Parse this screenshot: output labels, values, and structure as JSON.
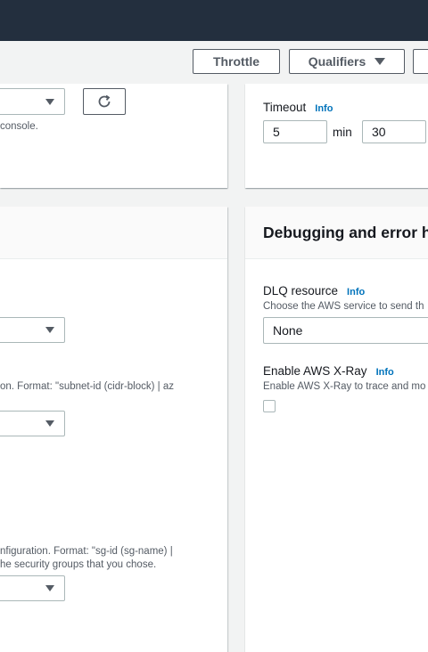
{
  "toolbar": {
    "throttle_label": "Throttle",
    "qualifiers_label": "Qualifiers"
  },
  "left_top": {
    "hint_text": "console."
  },
  "timeout": {
    "label": "Timeout",
    "info": "Info",
    "minutes_value": "5",
    "min_unit": "min",
    "seconds_value": "30"
  },
  "vpc": {
    "subnet_hint": "on. Format: \"subnet-id (cidr-block) | az",
    "sg_hint_line1": "nfiguration. Format: \"sg-id (sg-name) |",
    "sg_hint_line2": "he security groups that you chose."
  },
  "debugging": {
    "title": "Debugging and error h",
    "dlq_label": "DLQ resource",
    "dlq_info": "Info",
    "dlq_hint": "Choose the AWS service to send th",
    "dlq_value": "None",
    "xray_label": "Enable AWS X-Ray",
    "xray_info": "Info",
    "xray_hint": "Enable AWS X-Ray to trace and mo",
    "xray_checked": false
  },
  "colors": {
    "top_nav": "#232f3e",
    "link_info": "#0073bb",
    "page_bg": "#f2f3f3"
  },
  "icons": [
    "refresh-icon",
    "caret-down-icon"
  ]
}
